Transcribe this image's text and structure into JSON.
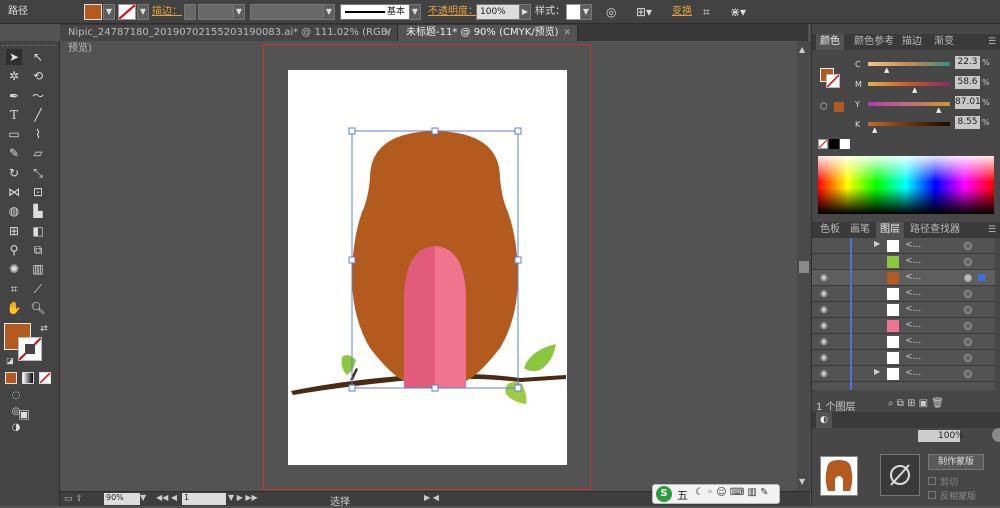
{
  "toolbar": {
    "path_label": "路径",
    "stroke_label": "描边：",
    "brush_label": "基本",
    "opacity_label": "不透明度：",
    "opacity_value": "100%",
    "style_label": "样式：",
    "transform_label": "变换"
  },
  "tabs": [
    {
      "label": "Nipic_24787180_20190702155203190083.ai* @ 111.02% (RGB/预览)"
    },
    {
      "label": "未标题-11* @ 90% (CMYK/预览)"
    }
  ],
  "colors": {
    "fill": "#b35a1f",
    "owl_body": "#b35a1f",
    "belly_left": "#e05c7a",
    "belly_right": "#f1748e",
    "branch": "#4a2a12",
    "leaf": "#8cc53f"
  },
  "color_panel": {
    "tabs": [
      "颜色",
      "颜色参考",
      "描边",
      "渐变"
    ],
    "channels": [
      {
        "label": "C",
        "value": "22.3"
      },
      {
        "label": "M",
        "value": "58.6"
      },
      {
        "label": "Y",
        "value": "87.01"
      },
      {
        "label": "K",
        "value": "8.55"
      }
    ],
    "unit": "%"
  },
  "layers_panel": {
    "tabs": [
      "色板",
      "画笔",
      "图层",
      "路径查找器"
    ],
    "rows": [
      "<...",
      "<...",
      "<...",
      "<...",
      "<...",
      "<...",
      "<...",
      "<...",
      "<..."
    ],
    "footer": "1 个图层"
  },
  "transparency_panel": {
    "opacity": "100%",
    "make_mask_label": "制作蒙版",
    "clip_label": "剪切",
    "invert_label": "反相蒙版"
  },
  "status": {
    "zoom": "90%",
    "page": "1",
    "tool": "选择"
  },
  "ime": {
    "label": "五"
  }
}
